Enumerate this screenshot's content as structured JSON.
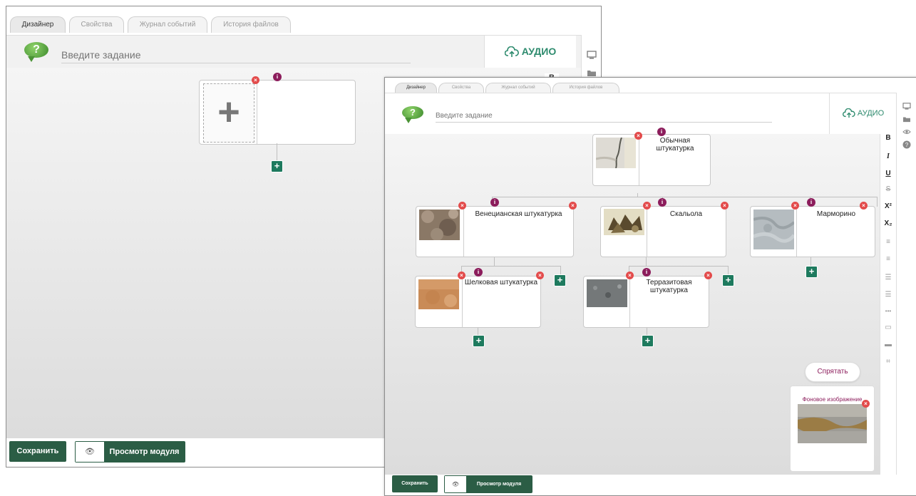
{
  "tabs": [
    "Дизайнер",
    "Свойства",
    "Журнал событий",
    "История файлов"
  ],
  "task": {
    "placeholder": "Введите задание",
    "help_glyph": "?"
  },
  "audio_label": "АУДИО",
  "badges": {
    "remove": "×",
    "info": "i",
    "add": "+"
  },
  "win1": {
    "empty_slot_glyph": "+",
    "sidebar_peek_glyph": "B"
  },
  "nodes": [
    {
      "label": "Обычная штукатурка"
    },
    {
      "label": "Венецианская штукатурка"
    },
    {
      "label": "Скальола"
    },
    {
      "label": "Марморино"
    },
    {
      "label": "Шелковая штукатурка"
    },
    {
      "label": "Терразитовая штукатурка"
    }
  ],
  "format_toolbar": [
    {
      "name": "bold",
      "glyph": "B"
    },
    {
      "name": "italic",
      "glyph": "I"
    },
    {
      "name": "underline",
      "glyph": "U"
    },
    {
      "name": "strikethrough",
      "glyph": "S"
    },
    {
      "name": "superscript",
      "glyph": "X²"
    },
    {
      "name": "subscript",
      "glyph": "X₂"
    },
    {
      "name": "align-left",
      "glyph": "≡"
    },
    {
      "name": "align-center",
      "glyph": "≡"
    },
    {
      "name": "bullet-list",
      "glyph": "☰"
    },
    {
      "name": "numbered-list",
      "glyph": "☰"
    },
    {
      "name": "more",
      "glyph": "•••"
    },
    {
      "name": "comment",
      "glyph": "▭"
    },
    {
      "name": "image",
      "glyph": "▬"
    },
    {
      "name": "crop",
      "glyph": "⌗"
    }
  ],
  "right_rail_icons": [
    "monitor-icon",
    "folder-icon",
    "eye-icon",
    "help-icon"
  ],
  "hide_button": "Спрятать",
  "background_image": {
    "title": "Фоновое изображение"
  },
  "bottom": {
    "save": "Сохранить",
    "eye_glyph": "👁",
    "preview": "Просмотр модуля"
  },
  "colors": {
    "accent": "#1e7a5e",
    "dark_green": "#2b5d45",
    "info": "#8c1d5c",
    "remove": "#e34b4b"
  }
}
